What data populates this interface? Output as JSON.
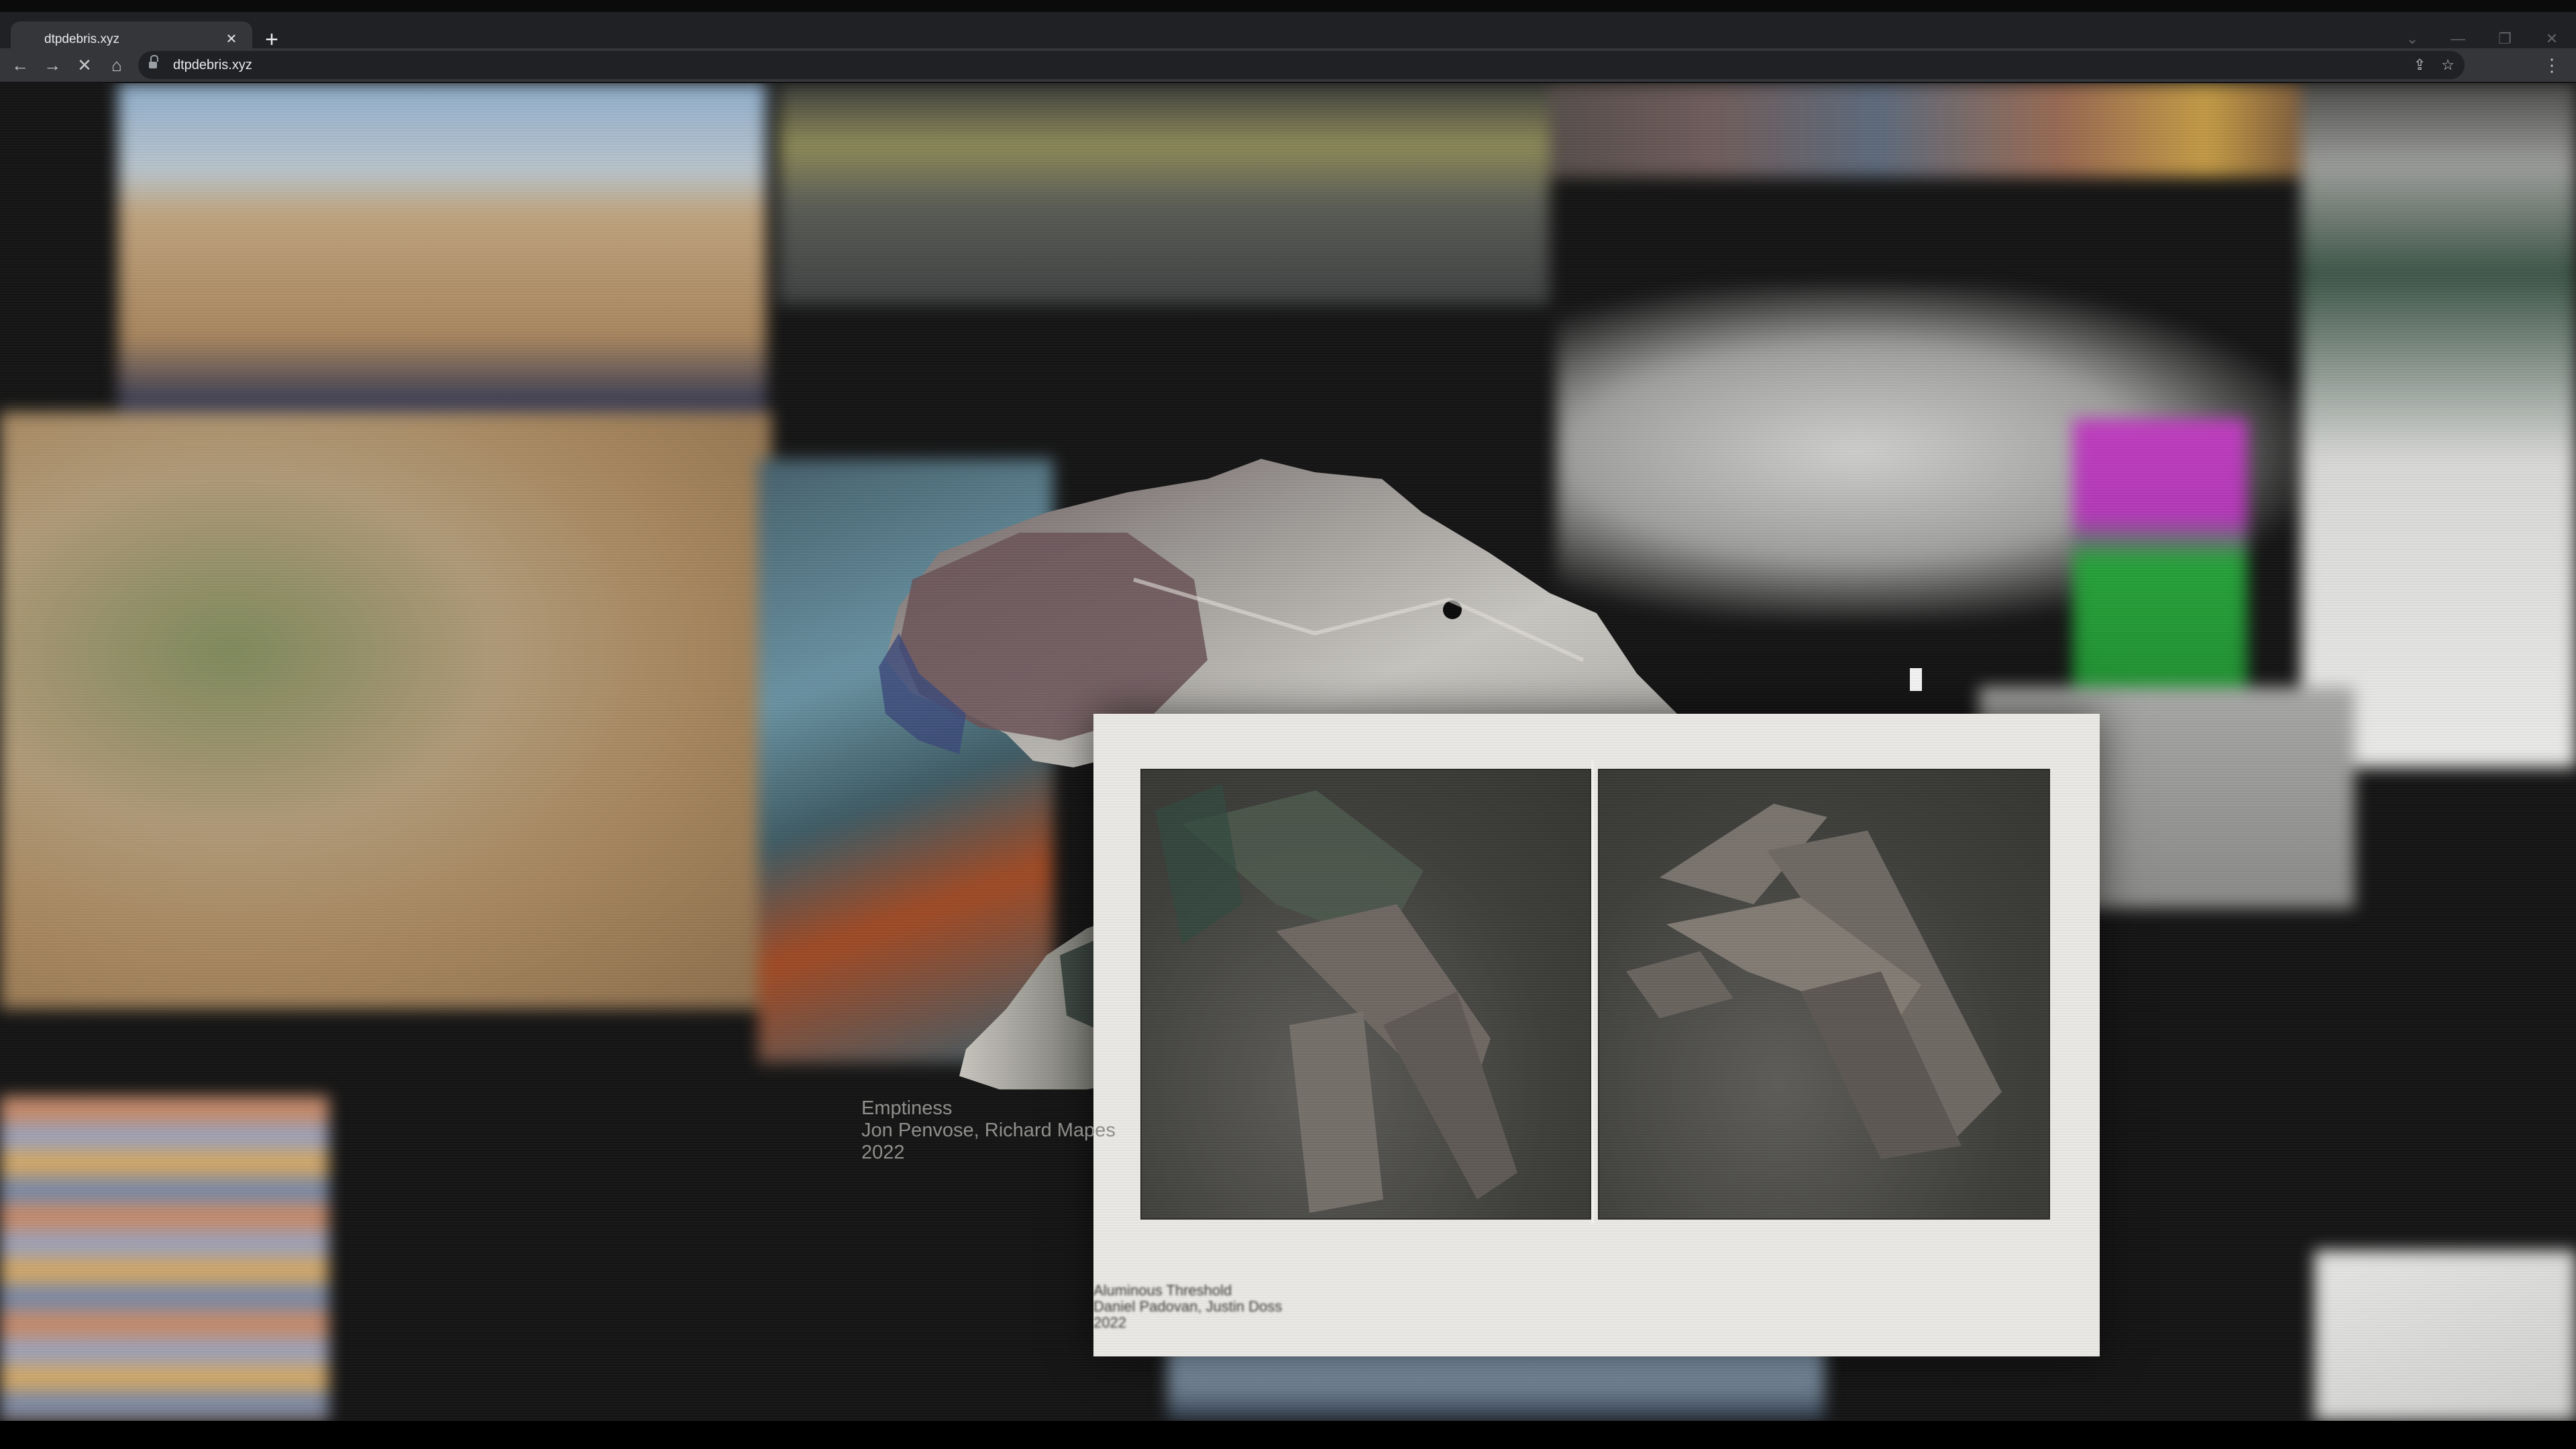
{
  "browser": {
    "tab_title": "dtpdebris.xyz",
    "url": "dtpdebris.xyz",
    "icons": {
      "tab_close": "×",
      "new_tab": "+",
      "back": "←",
      "forward": "→",
      "stop": "✕",
      "home": "⌂",
      "share": "⇪",
      "bookmark": "☆",
      "menu": "⋮",
      "tab_search": "⌄",
      "minimize": "—",
      "restore": "❐",
      "close_window": "✕"
    }
  },
  "artwork": {
    "title": "Emptiness",
    "artists": "Jon Penvose, Richard Mapes",
    "year": "2022"
  },
  "faded_caption": {
    "line1": "Aluminous Threshold",
    "line2": "Daniel Padovan, Justin Doss",
    "line3": "2022"
  },
  "colors": {
    "page_background": "#151515",
    "frame": "#ebe9e6",
    "caption_text": "#8f8f8c",
    "chrome_tabbar": "#202124",
    "chrome_toolbar": "#35363a"
  }
}
